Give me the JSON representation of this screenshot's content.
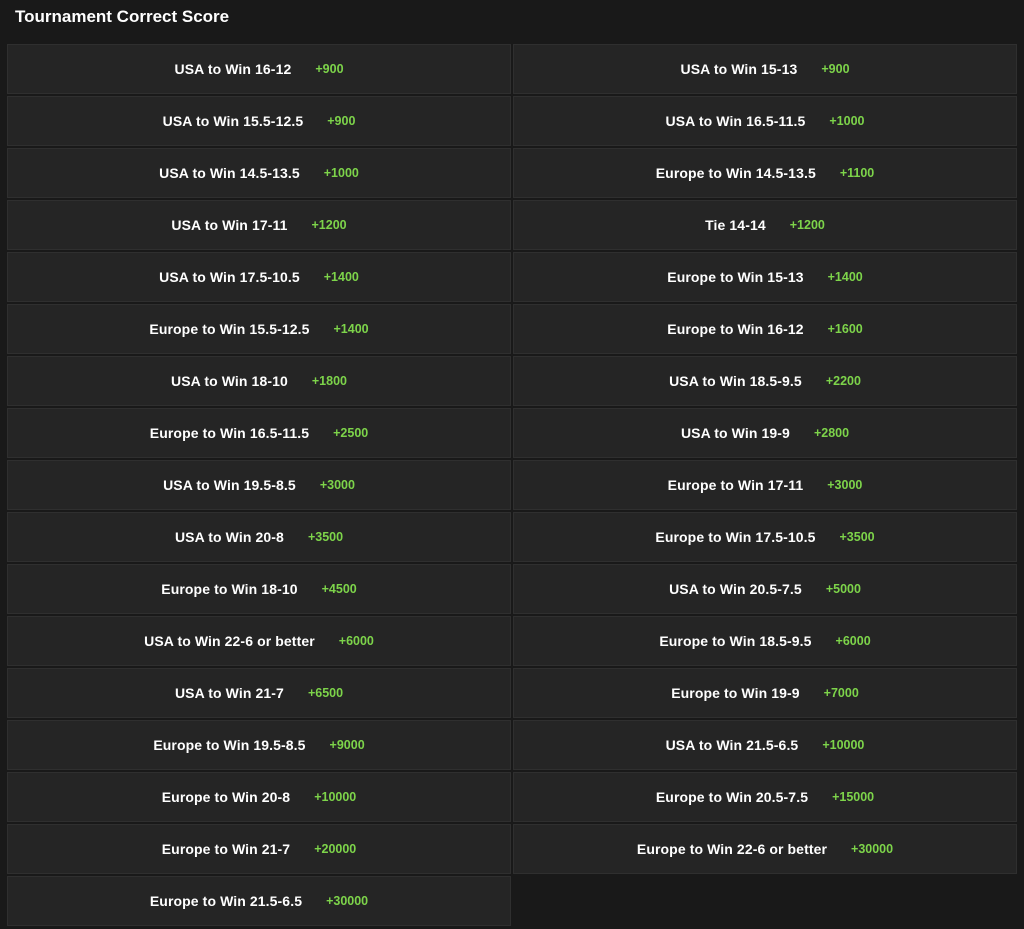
{
  "market": {
    "title": "Tournament Correct Score"
  },
  "outcomes": [
    {
      "label": "USA to Win 16-12",
      "odds": "+900"
    },
    {
      "label": "USA to Win 15-13",
      "odds": "+900"
    },
    {
      "label": "USA to Win 15.5-12.5",
      "odds": "+900"
    },
    {
      "label": "USA to Win 16.5-11.5",
      "odds": "+1000"
    },
    {
      "label": "USA to Win 14.5-13.5",
      "odds": "+1000"
    },
    {
      "label": "Europe to Win 14.5-13.5",
      "odds": "+1100"
    },
    {
      "label": "USA to Win 17-11",
      "odds": "+1200"
    },
    {
      "label": "Tie 14-14",
      "odds": "+1200"
    },
    {
      "label": "USA to Win 17.5-10.5",
      "odds": "+1400"
    },
    {
      "label": "Europe to Win 15-13",
      "odds": "+1400"
    },
    {
      "label": "Europe to Win 15.5-12.5",
      "odds": "+1400"
    },
    {
      "label": "Europe to Win 16-12",
      "odds": "+1600"
    },
    {
      "label": "USA to Win 18-10",
      "odds": "+1800"
    },
    {
      "label": "USA to Win 18.5-9.5",
      "odds": "+2200"
    },
    {
      "label": "Europe to Win 16.5-11.5",
      "odds": "+2500"
    },
    {
      "label": "USA to Win 19-9",
      "odds": "+2800"
    },
    {
      "label": "USA to Win 19.5-8.5",
      "odds": "+3000"
    },
    {
      "label": "Europe to Win 17-11",
      "odds": "+3000"
    },
    {
      "label": "USA to Win 20-8",
      "odds": "+3500"
    },
    {
      "label": "Europe to Win 17.5-10.5",
      "odds": "+3500"
    },
    {
      "label": "Europe to Win 18-10",
      "odds": "+4500"
    },
    {
      "label": "USA to Win 20.5-7.5",
      "odds": "+5000"
    },
    {
      "label": "USA to Win 22-6 or better",
      "odds": "+6000"
    },
    {
      "label": "Europe to Win 18.5-9.5",
      "odds": "+6000"
    },
    {
      "label": "USA to Win 21-7",
      "odds": "+6500"
    },
    {
      "label": "Europe to Win 19-9",
      "odds": "+7000"
    },
    {
      "label": "Europe to Win 19.5-8.5",
      "odds": "+9000"
    },
    {
      "label": "USA to Win 21.5-6.5",
      "odds": "+10000"
    },
    {
      "label": "Europe to Win 20-8",
      "odds": "+10000"
    },
    {
      "label": "Europe to Win 20.5-7.5",
      "odds": "+15000"
    },
    {
      "label": "Europe to Win 21-7",
      "odds": "+20000"
    },
    {
      "label": "Europe to Win 22-6 or better",
      "odds": "+30000"
    },
    {
      "label": "Europe to Win 21.5-6.5",
      "odds": "+30000"
    }
  ],
  "colors": {
    "background": "#191919",
    "cell": "#252525",
    "label": "#ffffff",
    "odds": "#7dd44a"
  }
}
